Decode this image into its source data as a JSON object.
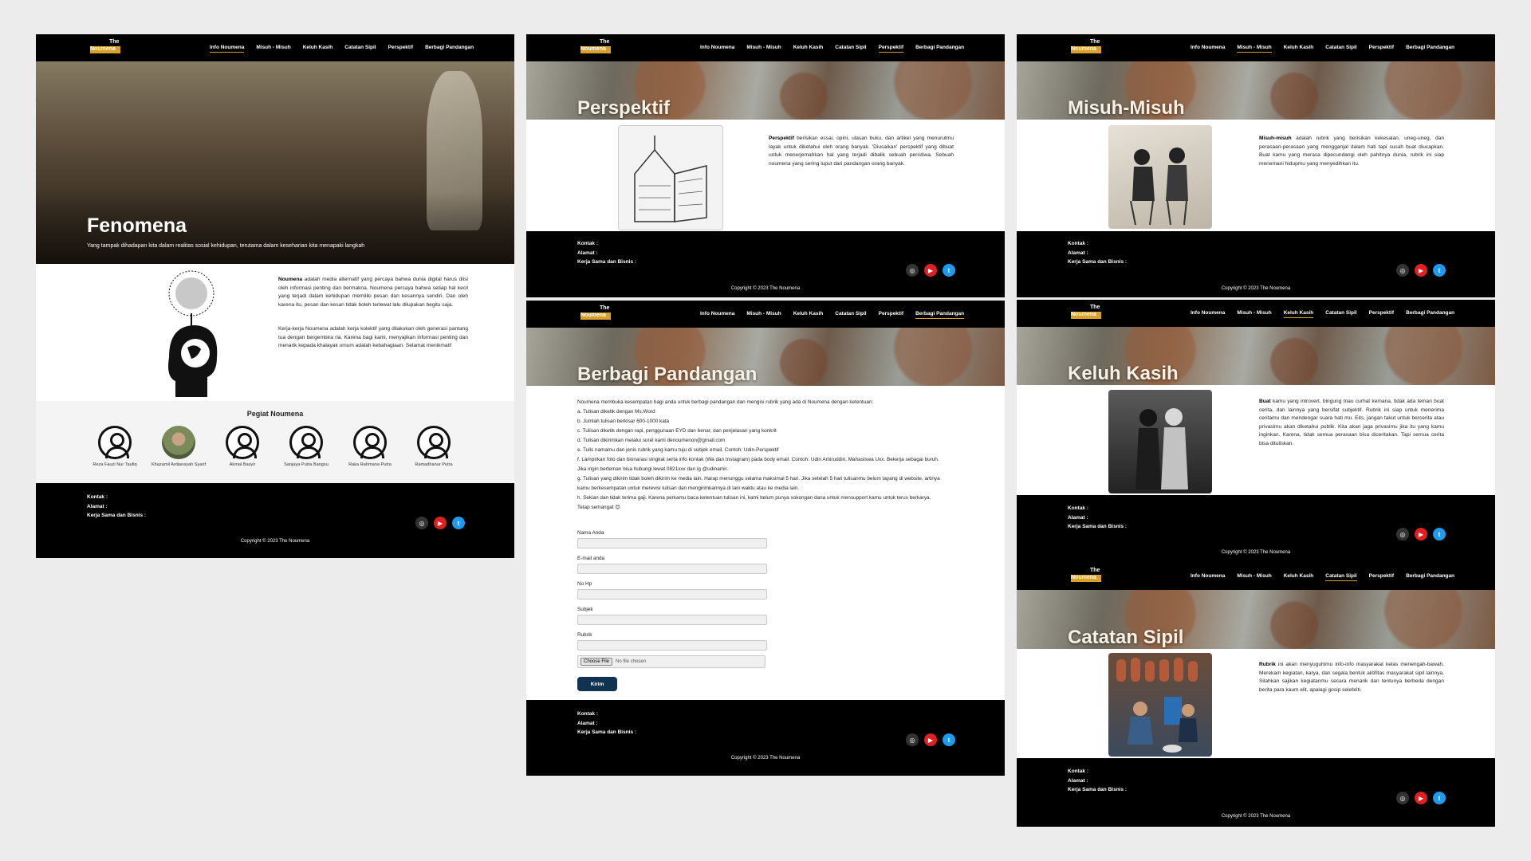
{
  "nav": {
    "brand_top": "The",
    "brand_bottom": "Noumena",
    "items": [
      "Info Noumena",
      "Misuh - Misuh",
      "Keluh Kasih",
      "Catatan Sipil",
      "Perspektif",
      "Berbagi Pandangan"
    ]
  },
  "home": {
    "hero_title": "Fenomena",
    "hero_subtitle": "Yang tampak dihadapan kita dalam realitas sosial kehidupan, terutama dalam keseharian kita menapaki langkah",
    "about_p1_bold": "Noumena",
    "about_p1": " adalah media alternatif yang percaya bahwa dunia digital harus diisi oleh informasi penting dan bermakna. Noumena percaya bahwa setiap hal kecil yang terjadi dalam kehidupan memiliki pesan dan kesannya sendiri. Dan oleh karena itu, pesan dan kesan tidak boleh terlewat lalu dilupakan begitu saja.",
    "about_p2": "Kerja-kerja Noumena adalah kerja kolektif yang dilakukan oleh generasi pantang tua dengan bergembira ria. Karena bagi kami, menyajikan informasi penting dan menarik kepada khalayak umum adalah kebahagiaan. Selamat menikmati!",
    "team_title": "Pegiat Noumena",
    "members": [
      "Reza Fauzi Nur Taufiq",
      "Khazamil Ardiansyah Syarif",
      "Akmal Basyir",
      "Sanjaya Putra Bangsu",
      "Raka Rahmana Putra",
      "Ramadhanur Putra"
    ]
  },
  "footer": {
    "kontak": "Kontak :",
    "alamat": "Alamat :",
    "kerja": "Kerja Sama dan Bisnis :",
    "copyright": "Copyright © 2023 The Noumena",
    "socials": [
      "instagram-icon",
      "youtube-icon",
      "twitter-icon"
    ],
    "social_colors": [
      "#333333",
      "#e02020",
      "#1d9bf0"
    ]
  },
  "perspektif": {
    "title": "Perspektif",
    "bold": "Perspektif",
    "text": " berisikan essai, opini, ulasan buku, dan artikel yang menurutmu layak untuk diketahui oleh orang banyak. 'Diusaikan' perspektif yang dibuat untuk menerjemahkan hal yang terjadi dibalik sebuah peristiwa. Sebuah noumena yang sering luput dari pandangan orang banyak."
  },
  "misuh": {
    "title": "Misuh-Misuh",
    "bold": "Misuh-misuh",
    "text": " adalah rubrik yang berisikan kekesalan, uneg-uneg, dan perasaan-perasaan yang mengganjal dalam hati tapi susah buat diucapkan. Buat kamu yang merasa dipecundangi oleh pahitnya dunia, rubrik ini siap menemani hidupmu yang menyedihkan itu."
  },
  "keluh": {
    "title": "Keluh Kasih",
    "bold": "Buat",
    "text": " kamu yang introvert, bingung mau curhat kemana, tidak ada teman buat cerita, dan lainnya yang bersifat subjektif. Rubrik ini siap untuk menerima ceritamu dan mendengar suara hati mu. Eits, jangan takut untuk bercerita atau privasimu akan diketahui publik. Kita akan jaga privasimu jika itu yang kamu inginkan. Karena, tidak semua perasaan bisa diceritakan. Tapi semua cerita bisa dituliskan."
  },
  "catatan": {
    "title": "Catatan Sipil",
    "bold": "Rubrik",
    "text": " ini akan menyuguhimu info-info masyarakat kelas menengah-bawah. Merekam kegiatan, karya, dan segala bentuk aktifitas masyarakat sipil lainnya. Silahkan sajikan kegiatanmu secara menarik dan tentunya berbeda dengan berita para kaum elit, apalagi gosip selebriti."
  },
  "berbagi": {
    "title": "Berbagi Pandangan",
    "intro": "Noumena membuka kesempatan bagi anda untuk berbagi pandangan dan mengisi rubrik yang ada di Noumena dengan ketentuan:",
    "rules": [
      "a. Tulisan diketik dengan Ms.Word",
      "b. Jumlah tulisan berkisar 600-1000 kata",
      "c. Tulisan diketik dengan rapi, penggunaan EYD dan benar, dan penjelasan yang konkrit",
      "d. Tulisan dikirimkan melalui surel kami denoumenon@gmail.com",
      "e. Tulis namamu dan jenis rubrik yang kamu tuju di subjek email. Contoh: Udin-Perspektif",
      "f. Lampirkan foto dan bionarasi singkat serta info kontak (Wa dan Instagram) pada body email. Contoh: Udin Amiruddin, Mahasiswa Uxx. Bekerja sebagai buruh. Jika ingin berteman bisa hubungi lewat 0821xxx dan ig @udinamir.",
      "g. Tulisan yang dikirim tidak boleh dikirim ke media lain. Harap menunggu selama maksimal 5 hari. Jika setelah 5 hari tulisanmu belum tayang di website, artinya kamu berkesempatan untuk merevisi tulisan dan mengirimkannya di lain waktu atau ke media lain.",
      "h. Sekian dan tidak terima gaji. Karena perkamu baca ketentuan tulisan ini, kami belum punya sokongan dana untuk mensupport kamu untuk terus berkarya. Tetap semangat 😊"
    ],
    "fields": [
      "Nama Anda",
      "E-mail anda",
      "No Hp",
      "Subjek",
      "Rubrik"
    ],
    "choose_file": "Choose File",
    "no_file": "No file chosen",
    "submit": "Kirim"
  }
}
